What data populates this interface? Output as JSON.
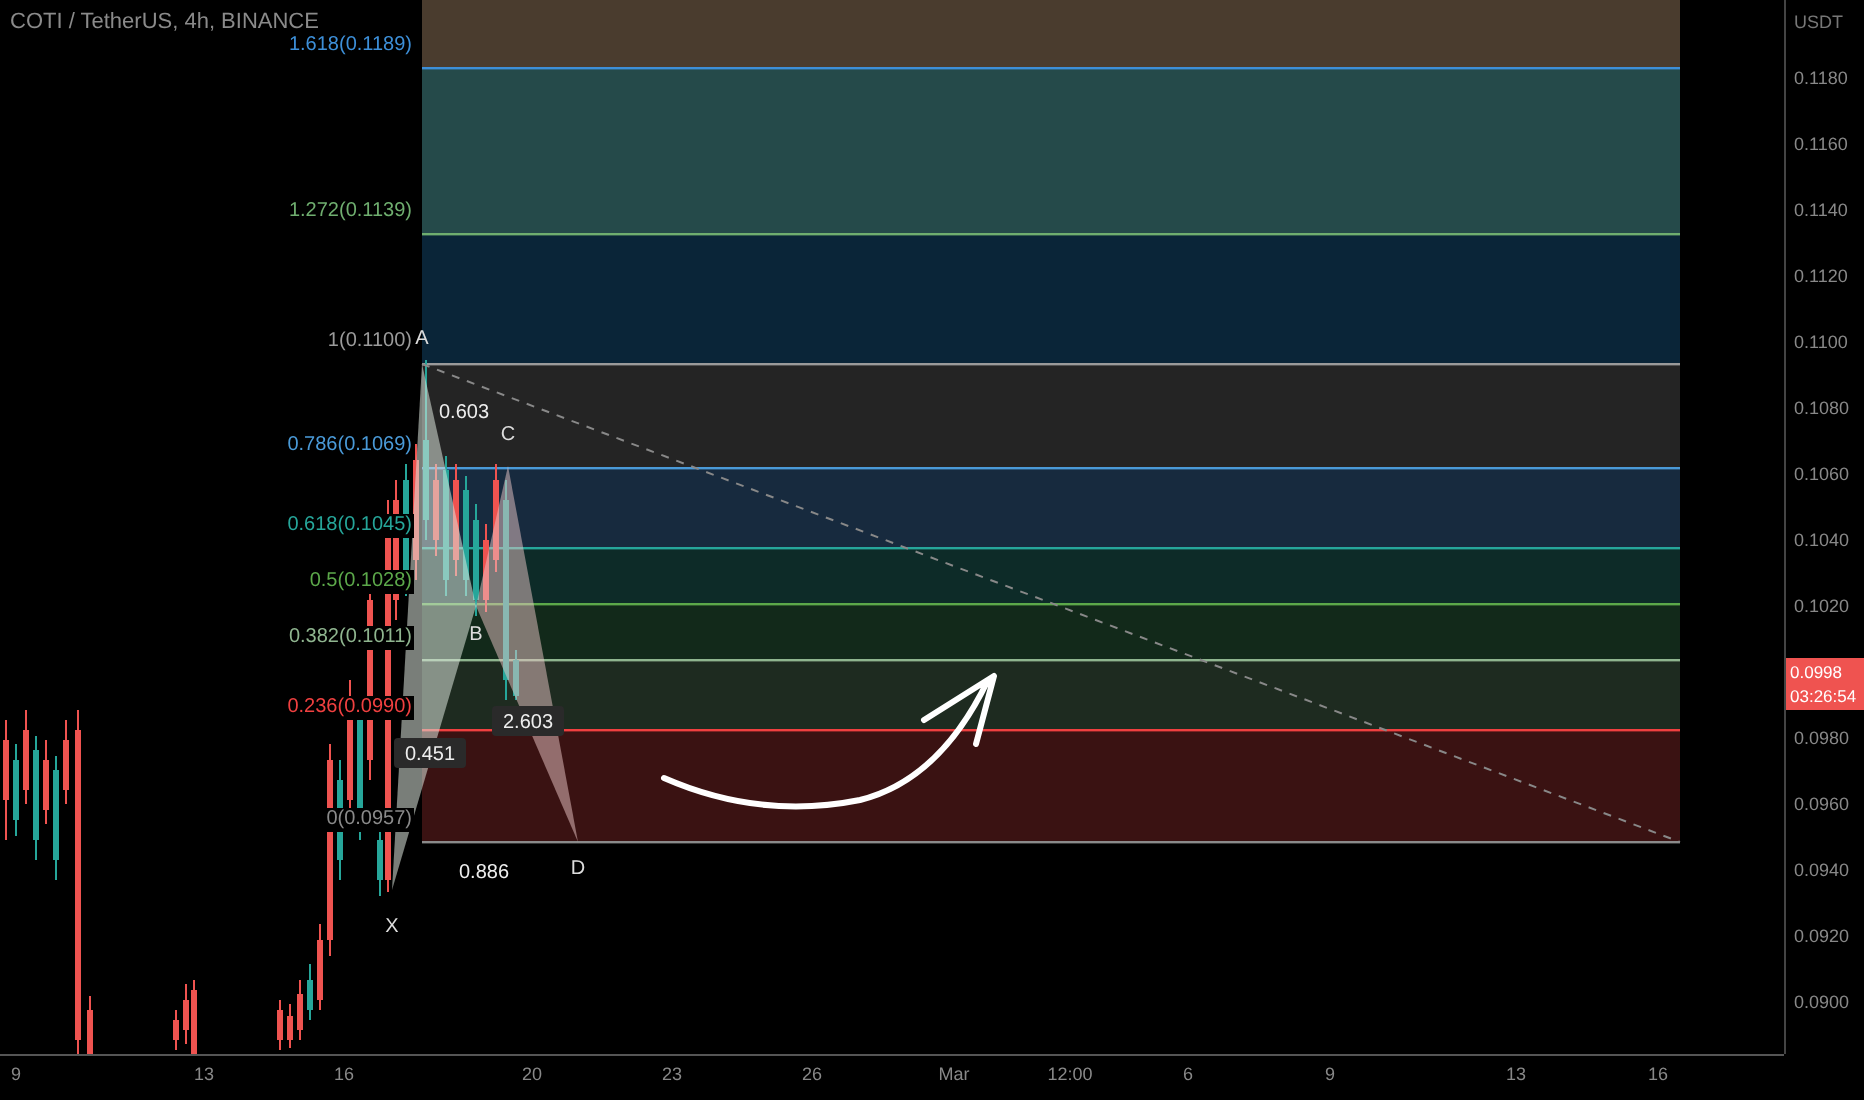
{
  "title": "COTI / TetherUS, 4h, BINANCE",
  "fib_levels": [
    {
      "label": "1.618(0.1189)",
      "color": "#3d8fd8"
    },
    {
      "label": "1.272(0.1139)",
      "color": "#6fae6f"
    },
    {
      "label": "1(0.1100)",
      "color": "#9a9a9a"
    },
    {
      "label": "0.786(0.1069)",
      "color": "#4a9ad8"
    },
    {
      "label": "0.618(0.1045)",
      "color": "#26a69a"
    },
    {
      "label": "0.5(0.1028)",
      "color": "#5ca84a"
    },
    {
      "label": "0.382(0.1011)",
      "color": "#8fb58f"
    },
    {
      "label": "0.236(0.0990)",
      "color": "#f04040"
    },
    {
      "label": "0(0.0957)",
      "color": "#8a8a8a"
    }
  ],
  "pattern": {
    "points": [
      {
        "label": "X"
      },
      {
        "label": "A"
      },
      {
        "label": "B"
      },
      {
        "label": "C"
      },
      {
        "label": "D"
      }
    ],
    "ratios": [
      {
        "label": "0.603",
        "kind": "plain"
      },
      {
        "label": "0.451",
        "kind": "boxed"
      },
      {
        "label": "2.603",
        "kind": "boxed"
      },
      {
        "label": "0.886",
        "kind": "plain"
      }
    ]
  },
  "price_axis": {
    "unit": "USDT",
    "items": [
      {
        "kind": "tick",
        "label": "0.1180"
      },
      {
        "kind": "tick",
        "label": "0.1160"
      },
      {
        "kind": "tick",
        "label": "0.1140"
      },
      {
        "kind": "tick",
        "label": "0.1120"
      },
      {
        "kind": "tick",
        "label": "0.1100"
      },
      {
        "kind": "tick",
        "label": "0.1080"
      },
      {
        "kind": "tick",
        "label": "0.1060"
      },
      {
        "kind": "tick",
        "label": "0.1040"
      },
      {
        "kind": "tick",
        "label": "0.1020"
      },
      {
        "kind": "badge",
        "label": "0.0998",
        "countdown": "03:26:54"
      },
      {
        "kind": "tick",
        "label": "0.0980"
      },
      {
        "kind": "tick",
        "label": "0.0960"
      },
      {
        "kind": "tick",
        "label": "0.0940"
      },
      {
        "kind": "tick",
        "label": "0.0920"
      },
      {
        "kind": "tick",
        "label": "0.0900"
      }
    ]
  },
  "time_axis": [
    "9",
    "13",
    "16",
    "20",
    "23",
    "26",
    "Mar",
    "12:00",
    "6",
    "9",
    "13",
    "16"
  ]
}
